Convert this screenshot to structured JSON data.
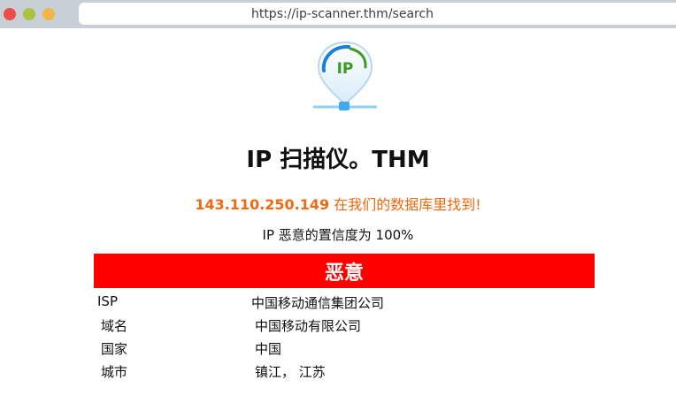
{
  "browser": {
    "url": "https://ip-scanner.thm/search"
  },
  "logo": {
    "text": "IP",
    "icon": "location-pin-ip-icon"
  },
  "page": {
    "title": "IP 扫描仪。THM",
    "found_ip": "143.110.250.149",
    "found_suffix": " 在我们的数据库里找到!",
    "confidence": "IP 恶意的置信度为 100%",
    "verdict": "恶意"
  },
  "details": [
    {
      "key": "ISP",
      "value": "中国移动通信集团公司"
    },
    {
      "key": "域名",
      "value": "中国移动有限公司"
    },
    {
      "key": "国家",
      "value": "中国"
    },
    {
      "key": "城市",
      "value": "镇江， 江苏"
    }
  ],
  "colors": {
    "accent_orange": "#ee6a10",
    "verdict_red": "#ff0000",
    "logo_green": "#3a9b22",
    "logo_blue": "#1e7fd8"
  }
}
